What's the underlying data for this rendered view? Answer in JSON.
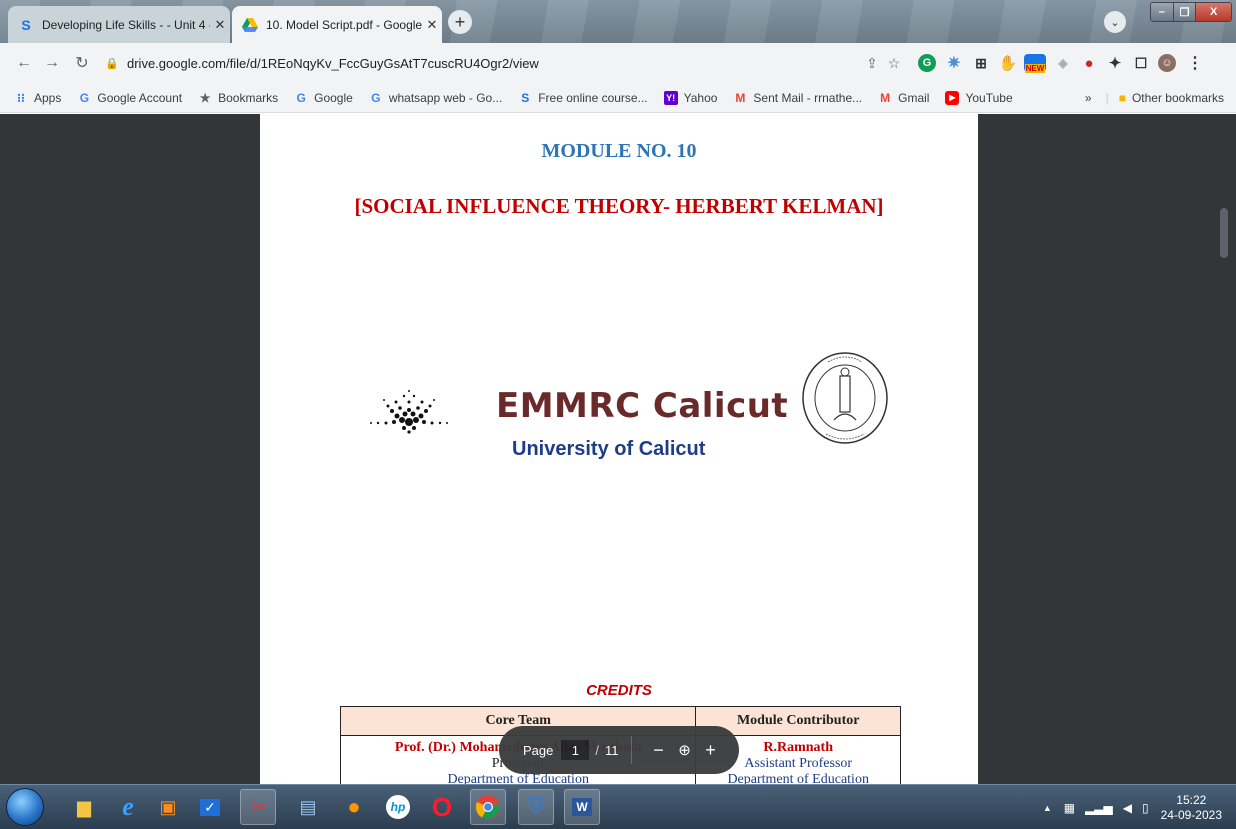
{
  "browser": {
    "tabs": [
      {
        "title": "Developing Life Skills - - Unit 4 -",
        "favicon": "S",
        "active": false
      },
      {
        "title": "10. Model Script.pdf - Google Dr",
        "favicon": "drive",
        "active": true
      }
    ],
    "url": "drive.google.com/file/d/1REoNqyKv_FccGuyGsAtT7cuscRU4Ogr2/view",
    "bookmarks": [
      {
        "label": "Apps",
        "icon": "apps-grid-icon"
      },
      {
        "label": "Google Account",
        "icon": "google-icon"
      },
      {
        "label": "Bookmarks",
        "icon": "star-icon"
      },
      {
        "label": "Google",
        "icon": "google-icon"
      },
      {
        "label": "whatsapp web - Go...",
        "icon": "google-icon"
      },
      {
        "label": "Free online course...",
        "icon": "s-icon"
      },
      {
        "label": "Yahoo",
        "icon": "yahoo-icon"
      },
      {
        "label": "Sent Mail - rrnathe...",
        "icon": "gmail-icon"
      },
      {
        "label": "Gmail",
        "icon": "gmail-icon"
      },
      {
        "label": "YouTube",
        "icon": "youtube-icon"
      }
    ],
    "other_bookmarks": "Other bookmarks",
    "ext_new_badge": "NEW"
  },
  "document": {
    "module_no": "MODULE NO. 10",
    "module_title": "[SOCIAL INFLUENCE THEORY- HERBERT KELMAN]",
    "logo_text": "EMMRC Calicut",
    "logo_subtext": "University of Calicut",
    "credits_heading": "CREDITS",
    "credits_table": {
      "headers": [
        "Core Team",
        "Module Contributor"
      ],
      "core_team": {
        "name": "Prof. (Dr.) Mohamedunni Alias Musthafa",
        "role": "Professor",
        "dept": "Department of Education"
      },
      "contributor": {
        "name": "R.Ramnath",
        "role": "Assistant Professor",
        "dept": "Department of Education"
      }
    }
  },
  "page_controls": {
    "label": "Page",
    "current": "1",
    "separator": "/",
    "total": "11"
  },
  "taskbar": {
    "time": "15:22",
    "date": "24-09-2023"
  }
}
